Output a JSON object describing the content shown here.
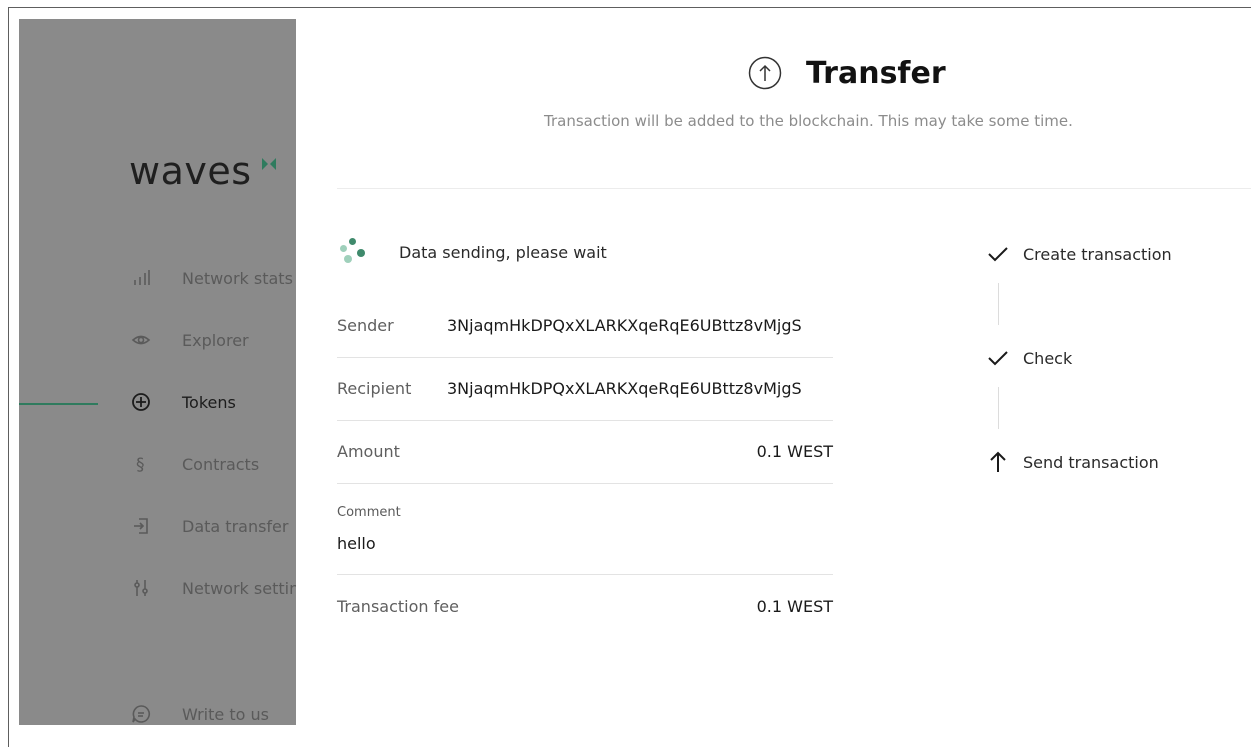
{
  "sidebar": {
    "logo": "waves",
    "nav": [
      {
        "label": "Network stats",
        "icon": "bar-chart-icon",
        "active": false
      },
      {
        "label": "Explorer",
        "icon": "eye-icon",
        "active": false
      },
      {
        "label": "Tokens",
        "icon": "coin-icon",
        "active": true
      },
      {
        "label": "Contracts",
        "icon": "section-icon",
        "active": false
      },
      {
        "label": "Data transfer",
        "icon": "login-icon",
        "active": false
      },
      {
        "label": "Network settings",
        "icon": "sliders-icon",
        "active": false
      }
    ],
    "footer": {
      "label": "Write to us",
      "icon": "chat-icon"
    }
  },
  "modal": {
    "title": "Transfer",
    "title_icon": "arrow-up-circle-icon",
    "subtitle": "Transaction will be added to the blockchain. This may take some time.",
    "status": "Data sending, please wait",
    "fields": {
      "sender_label": "Sender",
      "sender_value": "3NjaqmHkDPQxXLARKXqeRqE6UBttz8vMjgS",
      "recipient_label": "Recipient",
      "recipient_value": "3NjaqmHkDPQxXLARKXqeRqE6UBttz8vMjgS",
      "amount_label": "Amount",
      "amount_value": "0.1 WEST",
      "comment_label": "Comment",
      "comment_value": "hello",
      "fee_label": "Transaction fee",
      "fee_value": "0.1 WEST"
    },
    "steps": [
      {
        "label": "Create transaction",
        "icon": "check-icon",
        "state": "done"
      },
      {
        "label": "Check",
        "icon": "check-icon",
        "state": "done"
      },
      {
        "label": "Send transaction",
        "icon": "arrow-up-icon",
        "state": "current"
      }
    ]
  },
  "colors": {
    "accent_green": "#2f7b5e",
    "overlay_gray": "#8a8a8a",
    "spinner_dark": "#3f8a6c",
    "spinner_light": "#9fd0bb"
  }
}
